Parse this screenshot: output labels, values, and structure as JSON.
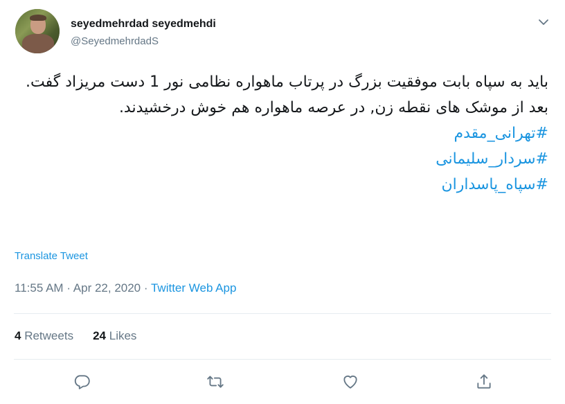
{
  "author": {
    "display_name": "seyedmehrdad seyedmehdi",
    "handle": "@SeyedmehrdadS"
  },
  "tweet": {
    "text": "باید به سپاه بابت موفقیت بزرگ در پرتاب ماهواره نظامی نور 1 دست مریزاد گفت. بعد از موشک های نقطه زن, در عرصه ماهواره هم خوش درخشیدند.",
    "hashtags": [
      "#تهرانی_مقدم",
      "#سردار_سلیمانی",
      "#سپاه_پاسداران"
    ]
  },
  "translate_label": "Translate Tweet",
  "meta": {
    "time": "11:55 AM",
    "separator": "·",
    "date": "Apr 22, 2020",
    "source": "Twitter Web App"
  },
  "stats": {
    "retweets_count": "4",
    "retweets_label": "Retweets",
    "likes_count": "24",
    "likes_label": "Likes"
  },
  "actions": [
    "reply-icon",
    "retweet-icon",
    "like-icon",
    "share-icon"
  ],
  "colors": {
    "link": "#1b95e0",
    "muted": "#657786",
    "text": "#14171a",
    "divider": "#e6ecf0"
  }
}
